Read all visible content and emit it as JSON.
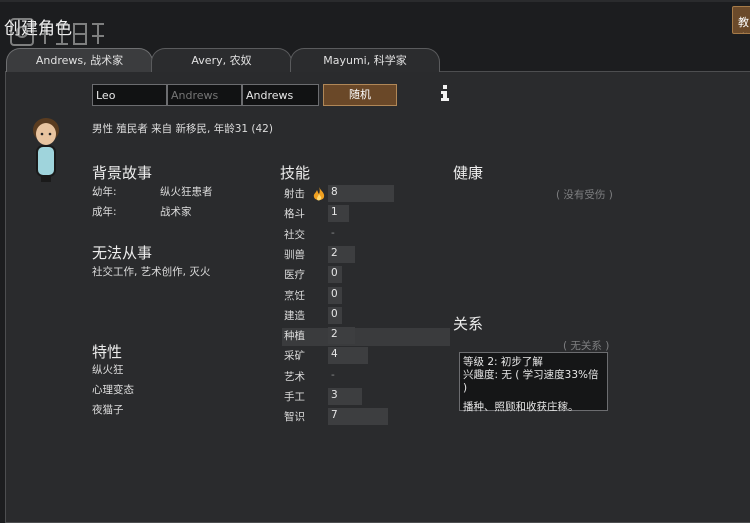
{
  "window": {
    "title": "创建角色",
    "tutorial_label": "教学"
  },
  "tabs": [
    {
      "label": "Andrews, 战术家"
    },
    {
      "label": "Avery, 农奴"
    },
    {
      "label": "Mayumi, 科学家"
    }
  ],
  "name_fields": {
    "first": "Leo",
    "nick_placeholder": "Andrews",
    "last": "Andrews"
  },
  "random_button": "随机",
  "character_desc": "男性 殖民者 来自 新移民, 年龄31 (42)",
  "backstory": {
    "heading": "背景故事",
    "childhood_label": "幼年:",
    "childhood_value": "纵火狂患者",
    "adulthood_label": "成年:",
    "adulthood_value": "战术家"
  },
  "incapable": {
    "heading": "无法从事",
    "text": "社交工作, 艺术创作, 灭火"
  },
  "traits": {
    "heading": "特性",
    "items": [
      "纵火狂",
      "心理变态",
      "夜猫子"
    ]
  },
  "skills": {
    "heading": "技能",
    "items": [
      {
        "name": "射击",
        "level": "8",
        "value": 8,
        "passion": true
      },
      {
        "name": "格斗",
        "level": "1",
        "value": 1,
        "passion": false
      },
      {
        "name": "社交",
        "level": "-",
        "value": 0,
        "passion": false
      },
      {
        "name": "驯兽",
        "level": "2",
        "value": 2,
        "passion": false
      },
      {
        "name": "医疗",
        "level": "0",
        "value": 0,
        "passion": false
      },
      {
        "name": "烹饪",
        "level": "0",
        "value": 0,
        "passion": false
      },
      {
        "name": "建造",
        "level": "0",
        "value": 0,
        "passion": false
      },
      {
        "name": "种植",
        "level": "2",
        "value": 2,
        "passion": false
      },
      {
        "name": "采矿",
        "level": "4",
        "value": 4,
        "passion": false
      },
      {
        "name": "艺术",
        "level": "-",
        "value": 0,
        "passion": false
      },
      {
        "name": "手工",
        "level": "3",
        "value": 3,
        "passion": false
      },
      {
        "name": "智识",
        "level": "7",
        "value": 7,
        "passion": false
      }
    ]
  },
  "health": {
    "heading": "健康",
    "status": "( 没有受伤 )"
  },
  "relations": {
    "heading": "关系",
    "status": "( 无关系 )"
  },
  "tooltip": {
    "line1": "等级 2: 初步了解",
    "line2": "兴趣度: 无 ( 学习速度33%倍 )",
    "line3": "播种、照顾和收获庄稼。"
  },
  "colors": {
    "background": "#2a2b2d",
    "button_accent": "#6a4828",
    "skill_bar": "#3d3e40"
  },
  "icons": [
    "info-icon",
    "flame-icon",
    "avatar-icon",
    "watermark-logo"
  ]
}
